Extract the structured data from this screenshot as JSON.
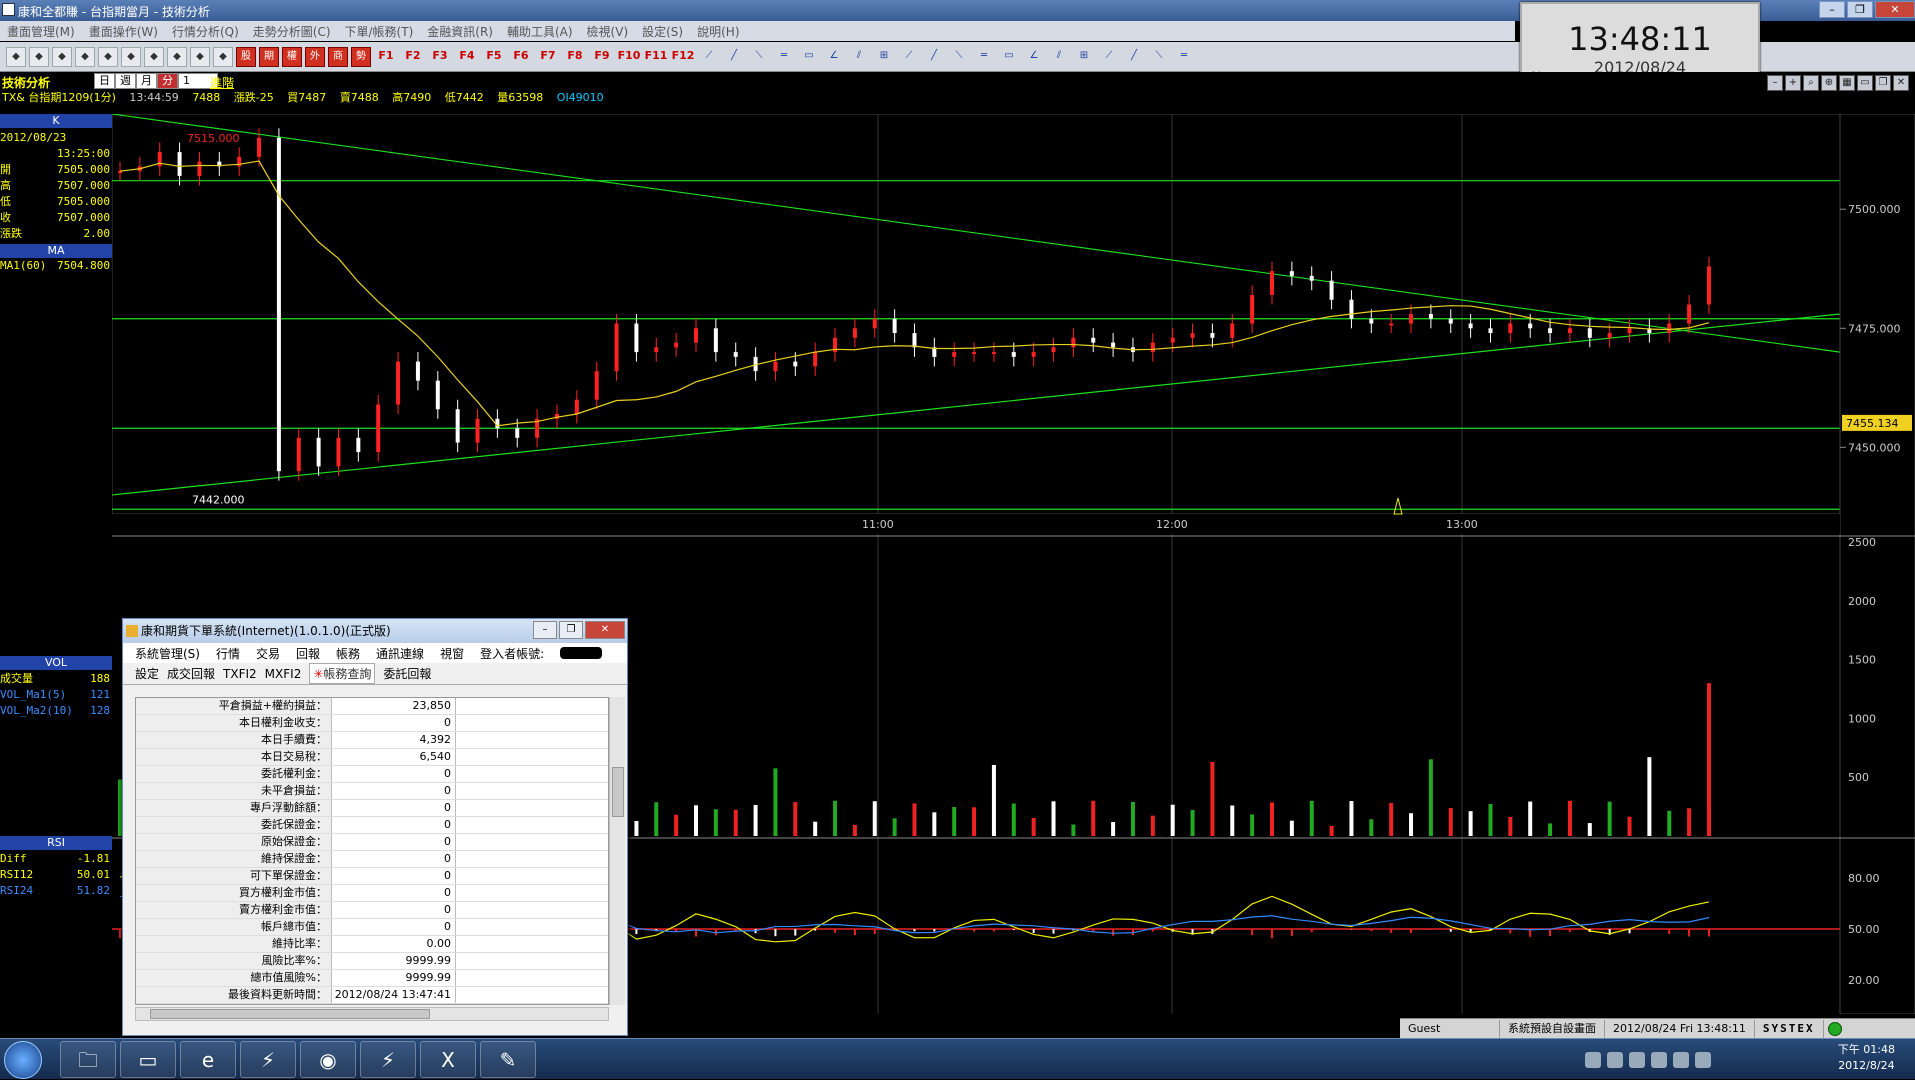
{
  "window": {
    "title": "康和全都賺 - 台指期當月 - 技術分析"
  },
  "menu": [
    "畫面管理(M)",
    "畫面操作(W)",
    "行情分析(Q)",
    "走勢分析圖(C)",
    "下單/帳務(T)",
    "金融資訊(R)",
    "輔助工具(A)",
    "檢視(V)",
    "設定(S)",
    "說明(H)"
  ],
  "toolbar": {
    "icons": [
      "chart-icon",
      "save-icon",
      "search-icon",
      "close-icon",
      "grid-icon",
      "window-icon",
      "gear-icon",
      "coin-icon",
      "printer-icon",
      "refresh-icon"
    ],
    "red_buttons": [
      "股",
      "期",
      "權",
      "外",
      "商",
      "勢"
    ],
    "fkeys": [
      "F1",
      "F2",
      "F3",
      "F4",
      "F5",
      "F6",
      "F7",
      "F8",
      "F9",
      "F10",
      "F11",
      "F12"
    ]
  },
  "clock": {
    "time": "13:48:11",
    "date": "2012/08/24",
    "mark": "N"
  },
  "info": {
    "section": "技術分析",
    "period_tabs": [
      "日",
      "週",
      "月",
      "分"
    ],
    "period_value": "1",
    "advance": "進階",
    "symbol": "TX& 台指期1209(1分)",
    "time": "13:44:59",
    "price": "7488",
    "change": "漲跌-25",
    "bid": "買7487",
    "ask": "賣7488",
    "high": "高7490",
    "low": "低7442",
    "volume": "量63598",
    "oi": "OI49010"
  },
  "k_panel": {
    "head": "K",
    "date": "2012/08/23",
    "time": "13:25:00",
    "rows": [
      {
        "k": "開",
        "v": "7505.000"
      },
      {
        "k": "高",
        "v": "7507.000"
      },
      {
        "k": "低",
        "v": "7505.000"
      },
      {
        "k": "收",
        "v": "7507.000"
      },
      {
        "k": "漲跌",
        "v": "2.00"
      }
    ]
  },
  "ma_panel": {
    "head": "MA",
    "rows": [
      {
        "k": "MA1(60)",
        "v": "7504.800"
      }
    ]
  },
  "vol_panel": {
    "head": "VOL",
    "rows": [
      {
        "k": "成交量",
        "v": "188"
      },
      {
        "k": "VOL_Ma1(5)",
        "v": "121"
      },
      {
        "k": "VOL_Ma2(10)",
        "v": "128"
      }
    ]
  },
  "rsi_panel": {
    "head": "RSI",
    "rows": [
      {
        "k": "Diff",
        "v": "-1.81"
      },
      {
        "k": "RSI12",
        "v": "50.01"
      },
      {
        "k": "RSI24",
        "v": "51.82"
      }
    ]
  },
  "chart_data": {
    "type": "candlestick",
    "title": "台指期1209(1分)",
    "price_axis": {
      "ticks": [
        "7500.000",
        "7475.000",
        "7450.000"
      ],
      "range": [
        7436,
        7520
      ],
      "current_marker": "7455.134"
    },
    "time_axis": [
      "11:00",
      "12:00",
      "13:00"
    ],
    "annotations": {
      "high_label": "7515.000",
      "low_label": "7442.000"
    },
    "volume_axis": {
      "ticks": [
        "2500",
        "2000",
        "1500",
        "1000",
        "500"
      ],
      "range": [
        0,
        2500
      ]
    },
    "rsi_axis": {
      "ticks": [
        "80.00",
        "50.00",
        "20.00"
      ],
      "range": [
        0,
        100
      ]
    },
    "horizontal_lines": [
      7522,
      7506,
      7477,
      7454,
      7437
    ],
    "price_samples": [
      7508,
      7509,
      7512,
      7507,
      7510,
      7509,
      7511,
      7515,
      7445,
      7452,
      7446,
      7452,
      7449,
      7459,
      7468,
      7464,
      7458,
      7451,
      7456,
      7454,
      7452,
      7456,
      7457,
      7460,
      7466,
      7476,
      7470,
      7471,
      7472,
      7475,
      7470,
      7469,
      7466,
      7468,
      7467,
      7470,
      7473,
      7475,
      7477,
      7474,
      7471,
      7469,
      7470,
      7470,
      7470,
      7469,
      7470,
      7471,
      7473,
      7472,
      7471,
      7470,
      7472,
      7473,
      7474,
      7473,
      7476,
      7482,
      7487,
      7486,
      7485,
      7481,
      7477,
      7476,
      7476,
      7478,
      7477,
      7476,
      7475,
      7474,
      7476,
      7475,
      7474,
      7475,
      7473,
      7474,
      7475,
      7474,
      7476,
      7480,
      7488
    ]
  },
  "order_window": {
    "title": "康和期貨下單系統(Internet)(1.0.1.0)(正式版)",
    "menu": [
      "系統管理(S)",
      "行情",
      "交易",
      "回報",
      "帳務",
      "通訊連線",
      "視窗",
      "登入者帳號:"
    ],
    "tabs": [
      "設定",
      "成交回報",
      "TXFI2",
      "MXFI2",
      "帳務查詢",
      "委託回報"
    ],
    "rows": [
      {
        "k": "平倉損益+權約損益：",
        "v": "23,850"
      },
      {
        "k": "本日權利金收支：",
        "v": "0"
      },
      {
        "k": "本日手續費：",
        "v": "4,392"
      },
      {
        "k": "本日交易稅：",
        "v": "6,540"
      },
      {
        "k": "委託權利金：",
        "v": "0"
      },
      {
        "k": "未平倉損益：",
        "v": "0"
      },
      {
        "k": "專戶浮動餘額：",
        "v": "0"
      },
      {
        "k": "委託保證金：",
        "v": "0"
      },
      {
        "k": "原始保證金：",
        "v": "0"
      },
      {
        "k": "維持保證金：",
        "v": "0"
      },
      {
        "k": "可下單保證金：",
        "v": "0"
      },
      {
        "k": "買方權利金市值：",
        "v": "0"
      },
      {
        "k": "賣方權利金市值：",
        "v": "0"
      },
      {
        "k": "帳戶總市值：",
        "v": "0"
      },
      {
        "k": "維持比率：",
        "v": "0.00"
      },
      {
        "k": "風險比率%：",
        "v": "9999.99"
      },
      {
        "k": "總市值風險%：",
        "v": "9999.99"
      },
      {
        "k": "最後資料更新時間：",
        "v": "2012/08/24 13:47:41"
      }
    ]
  },
  "statusbar": {
    "user": "Guest",
    "layout": "系統預設自設畫面",
    "datetime": "2012/08/24 Fri 13:48:11",
    "brand": "SYSTEX"
  },
  "taskbar": {
    "clock_time": "下午 01:48",
    "clock_date": "2012/8/24"
  }
}
